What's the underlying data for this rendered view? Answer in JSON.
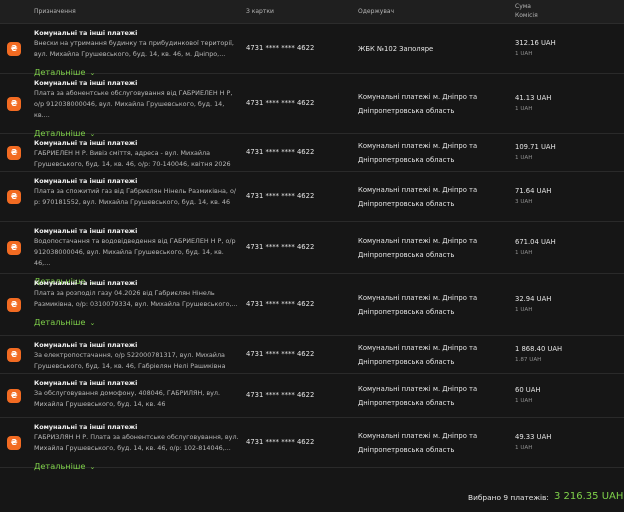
{
  "header": {
    "col_purpose": "Призначення",
    "col_card": "З картки",
    "col_recipient": "Одержувач",
    "col_amount": "Сума",
    "col_fee": "Комісія"
  },
  "details_label": "Детальніше",
  "payments": [
    {
      "title": "Комунальні та інші платежі",
      "description": "Внески на утримання будинку та прибудинкової території, вул. Михайла Грушевського, буд. 14, кв. 46, м. Дніпро,...",
      "card": "4731 **** **** 4622",
      "recipient": "ЖБК №102 Заполяре",
      "amount": "312.16 UAH",
      "fee": "1 UAH",
      "has_details": true
    },
    {
      "title": "Комунальні та інші платежі",
      "description": "Плата за абонентське обслуговування від ГАБРИЕЛЕН Н Р, о/р 912038000046, вул. Михайла Грушевського, буд. 14, кв....",
      "card": "4731 **** **** 4622",
      "recipient": "Комунальні платежі м. Дніпро та Дніпропетровська область",
      "amount": "41.13 UAH",
      "fee": "1 UAH",
      "has_details": true
    },
    {
      "title": "Комунальні та інші платежі",
      "description": "ГАБРИЕЛЕН Н Р. Вивіз сміття, адреса - вул. Михайла Грушевського, буд. 14, кв. 46, о/р: 70-140046, квітня 2026",
      "card": "4731 **** **** 4622",
      "recipient": "Комунальні платежі м. Дніпро та Дніпропетровська область",
      "amount": "109.71 UAH",
      "fee": "1 UAH",
      "has_details": false
    },
    {
      "title": "Комунальні та інші платежі",
      "description": "Плата за спожитий газ від Габриєлян Нінель Размиківна, о/р: 970181552, вул. Михайла Грушевського, буд. 14, кв. 46",
      "card": "4731 **** **** 4622",
      "recipient": "Комунальні платежі м. Дніпро та Дніпропетровська область",
      "amount": "71.64 UAH",
      "fee": "3 UAH",
      "has_details": false
    },
    {
      "title": "Комунальні та інші платежі",
      "description": "Водопостачання та водовідведення від ГАБРИЕЛЕН Н Р, о/р 912038000046, вул. Михайла Грушевського, буд. 14, кв. 46,...",
      "card": "4731 **** **** 4622",
      "recipient": "Комунальні платежі м. Дніпро та Дніпропетровська область",
      "amount": "671.04 UAH",
      "fee": "1 UAH",
      "has_details": true
    },
    {
      "title": "Комунальні та інші платежі",
      "description": "Плата за розподіл газу 04.2026 від Габриєлян Нінель Размиківна, о/р: 0310079334, вул. Михайла Грушевського,...",
      "card": "4731 **** **** 4622",
      "recipient": "Комунальні платежі м. Дніпро та Дніпропетровська область",
      "amount": "32.94 UAH",
      "fee": "1 UAH",
      "has_details": true
    },
    {
      "title": "Комунальні та інші платежі",
      "description": "За електропостачання, о/р 522000781317, вул. Михайла Грушевського, буд. 14, кв. 46, Габріелян Нелі Рашиківна",
      "card": "4731 **** **** 4622",
      "recipient": "Комунальні платежі м. Дніпро та Дніпропетровська область",
      "amount": "1 868.40 UAH",
      "fee": "1.87 UAH",
      "has_details": false
    },
    {
      "title": "Комунальні та інші платежі",
      "description": "За обслуговування домофону, 408046, ГАБРИЛЯН, вул. Михайла Грушевського, буд. 14, кв. 46",
      "card": "4731 **** **** 4622",
      "recipient": "Комунальні платежі м. Дніпро та Дніпропетровська область",
      "amount": "60 UAH",
      "fee": "1 UAH",
      "has_details": false
    },
    {
      "title": "Комунальні та інші платежі",
      "description": "ГАБРИЗЛЯН Н Р. Плата за абонентське обслуговування, вул. Михайла Грушевського, буд. 14, кв. 46, о/р: 102-814046,...",
      "card": "4731 **** **** 4622",
      "recipient": "Комунальні платежі м. Дніпро та Дніпропетровська область",
      "amount": "49.33 UAH",
      "fee": "1 UAH",
      "has_details": true
    }
  ],
  "footer": {
    "selected_label": "Вибрано 9 платежів:",
    "total": "3 216.35 UAH"
  },
  "colors": {
    "accent": "#7fd14a",
    "icon": "#f26b22",
    "background": "#161616"
  },
  "icon_name": "utility-payment-icon",
  "details_icon_name": "chevron-down-icon"
}
